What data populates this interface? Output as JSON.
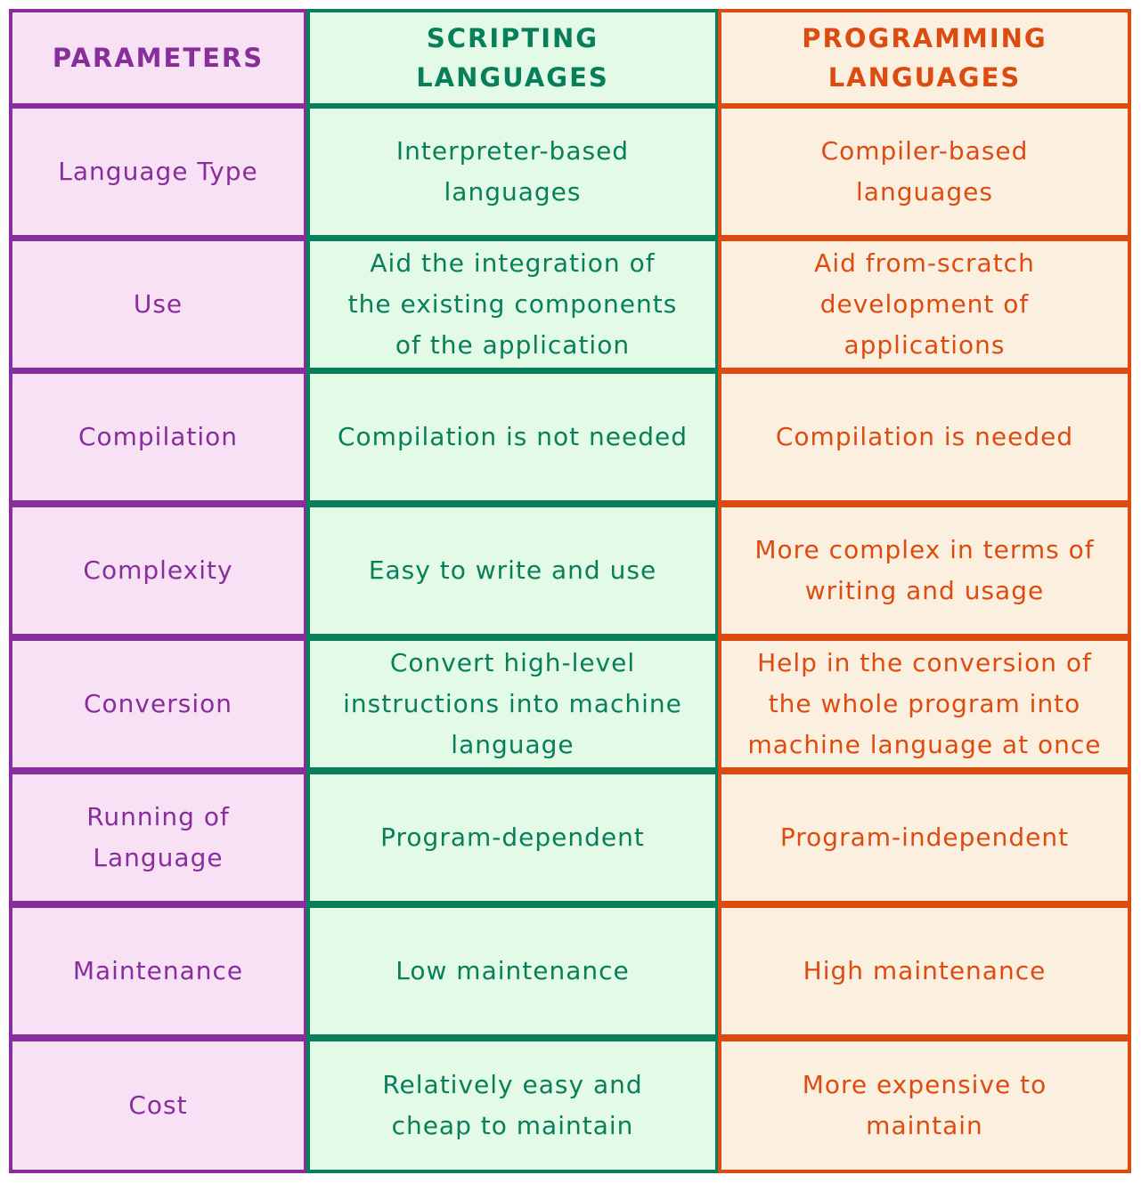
{
  "table": {
    "headers": [
      "PARAMETERS",
      "SCRIPTING\nLANGUAGES",
      "PROGRAMMING\nLANGUAGES"
    ],
    "rows": [
      [
        "Language Type",
        "Interpreter-based\nlanguages",
        "Compiler-based\nlanguages"
      ],
      [
        "Use",
        "Aid the integration of\nthe existing components\nof the application",
        "Aid from-scratch\ndevelopment of\napplications"
      ],
      [
        "Compilation",
        "Compilation is not needed",
        "Compilation is needed"
      ],
      [
        "Complexity",
        "Easy to write and use",
        "More complex in terms of\nwriting and usage"
      ],
      [
        "Conversion",
        "Convert high-level\ninstructions into machine\nlanguage",
        "Help in the conversion of\nthe whole program into\nmachine language at once"
      ],
      [
        "Running of\nLanguage",
        "Program-dependent",
        "Program-independent"
      ],
      [
        "Maintenance",
        "Low maintenance",
        "High maintenance"
      ],
      [
        "Cost",
        "Relatively easy and\ncheap to maintain",
        "More expensive to\nmaintain"
      ]
    ]
  },
  "colors": {
    "parameters_stroke": "#862e9c",
    "parameters_fill": "#f9e1f5",
    "scripting_stroke": "#087f5b",
    "scripting_fill": "#e3fae6",
    "programming_stroke": "#dc4c10",
    "programming_fill": "#fbf0e0"
  }
}
